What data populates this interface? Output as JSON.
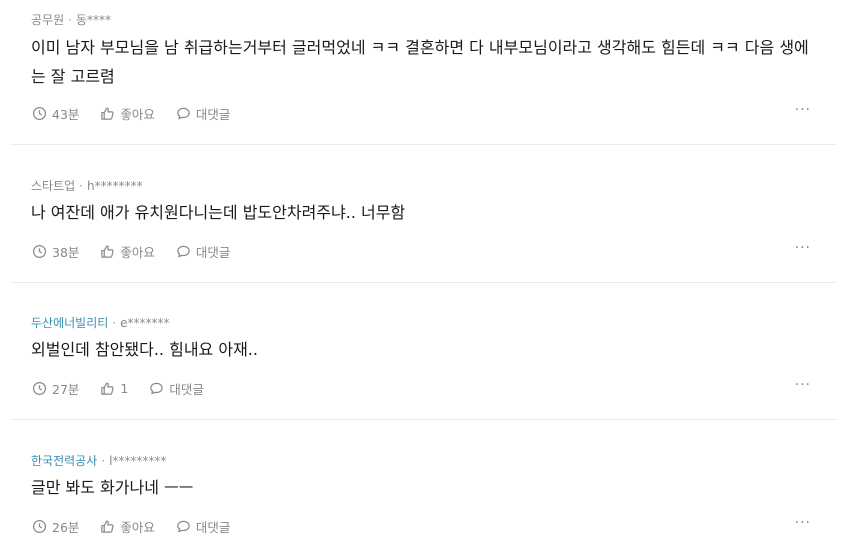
{
  "comments": [
    {
      "company": "공무원",
      "author": "동****",
      "text": "이미 남자 부모님을 남 취급하는거부터 글러먹었네 ㅋㅋ 결혼하면 다 내부모님이라고 생각해도 힘든데 ㅋㅋ 다음 생에는 잘 고르렴",
      "time": "43분",
      "like_label": "좋아요",
      "reply_label": "대댓글"
    },
    {
      "company": "스타트업",
      "author": "h********",
      "text": "나 여잔데 애가 유치원다니는데 밥도안차려주냐.. 너무함",
      "time": "38분",
      "like_label": "좋아요",
      "reply_label": "대댓글"
    },
    {
      "company": "두산에너빌리티",
      "author": "e*******",
      "text": "외벌인데 참안됐다.. 힘내요 아재..",
      "time": "27분",
      "like_label": "1",
      "reply_label": "대댓글"
    },
    {
      "company": "한국전력공사",
      "author": "l*********",
      "text": "글만 봐도 화가나네 ㅡㅡ",
      "time": "26분",
      "like_label": "좋아요",
      "reply_label": "대댓글"
    }
  ],
  "more_label": "···",
  "separator": "·",
  "colors": {
    "company_link": "#3b8fb5",
    "meta_gray": "#8a8a8a",
    "divider": "#ebebeb"
  }
}
